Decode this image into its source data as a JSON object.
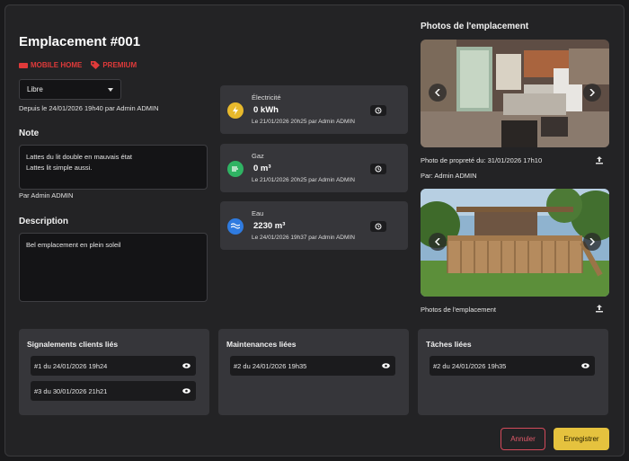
{
  "header": {
    "title": "Emplacement #001",
    "tags": [
      "MOBILE HOME",
      "PREMIUM"
    ]
  },
  "status": {
    "selected": "Libre",
    "since": "Depuis le 24/01/2026 19h40 par Admin ADMIN"
  },
  "note": {
    "label": "Note",
    "line1": "Lattes du lit double en mauvais état",
    "line2": "Lattes lit simple aussi.",
    "author": "Par Admin ADMIN"
  },
  "description": {
    "label": "Description",
    "value": "Bel emplacement en plein soleil"
  },
  "meters": [
    {
      "label": "Électricité",
      "value": "0 kWh",
      "updated": "Le 21/01/2026 20h25 par Admin ADMIN",
      "color": "#e8b92c",
      "icon": "lightning-icon"
    },
    {
      "label": "Gaz",
      "value": "0 m³",
      "updated": "Le 21/01/2026 20h25 par Admin ADMIN",
      "color": "#2fb363",
      "icon": "flame-icon"
    },
    {
      "label": "Eau",
      "value": "2230 m³",
      "updated": "Le 24/01/2026 19h37 par Admin ADMIN",
      "color": "#2f7be0",
      "icon": "water-icon"
    }
  ],
  "photos": {
    "title": "Photos de l'emplacement",
    "first_caption": "Photo de propreté du: 31/01/2026 17h10",
    "first_author": "Par: Admin ADMIN",
    "second_caption": "Photos de l'emplacement"
  },
  "linked": {
    "reports_title": "Signalements clients liés",
    "reports": [
      "#1 du 24/01/2026 19h24",
      "#3 du 30/01/2026 21h21"
    ],
    "maintenance_title": "Maintenances liées",
    "maintenance": [
      "#2 du 24/01/2026 19h35"
    ],
    "tasks_title": "Tâches liées",
    "tasks": [
      "#2 du 24/01/2026 19h35"
    ]
  },
  "actions": {
    "cancel": "Annuler",
    "save": "Enregistrer"
  }
}
